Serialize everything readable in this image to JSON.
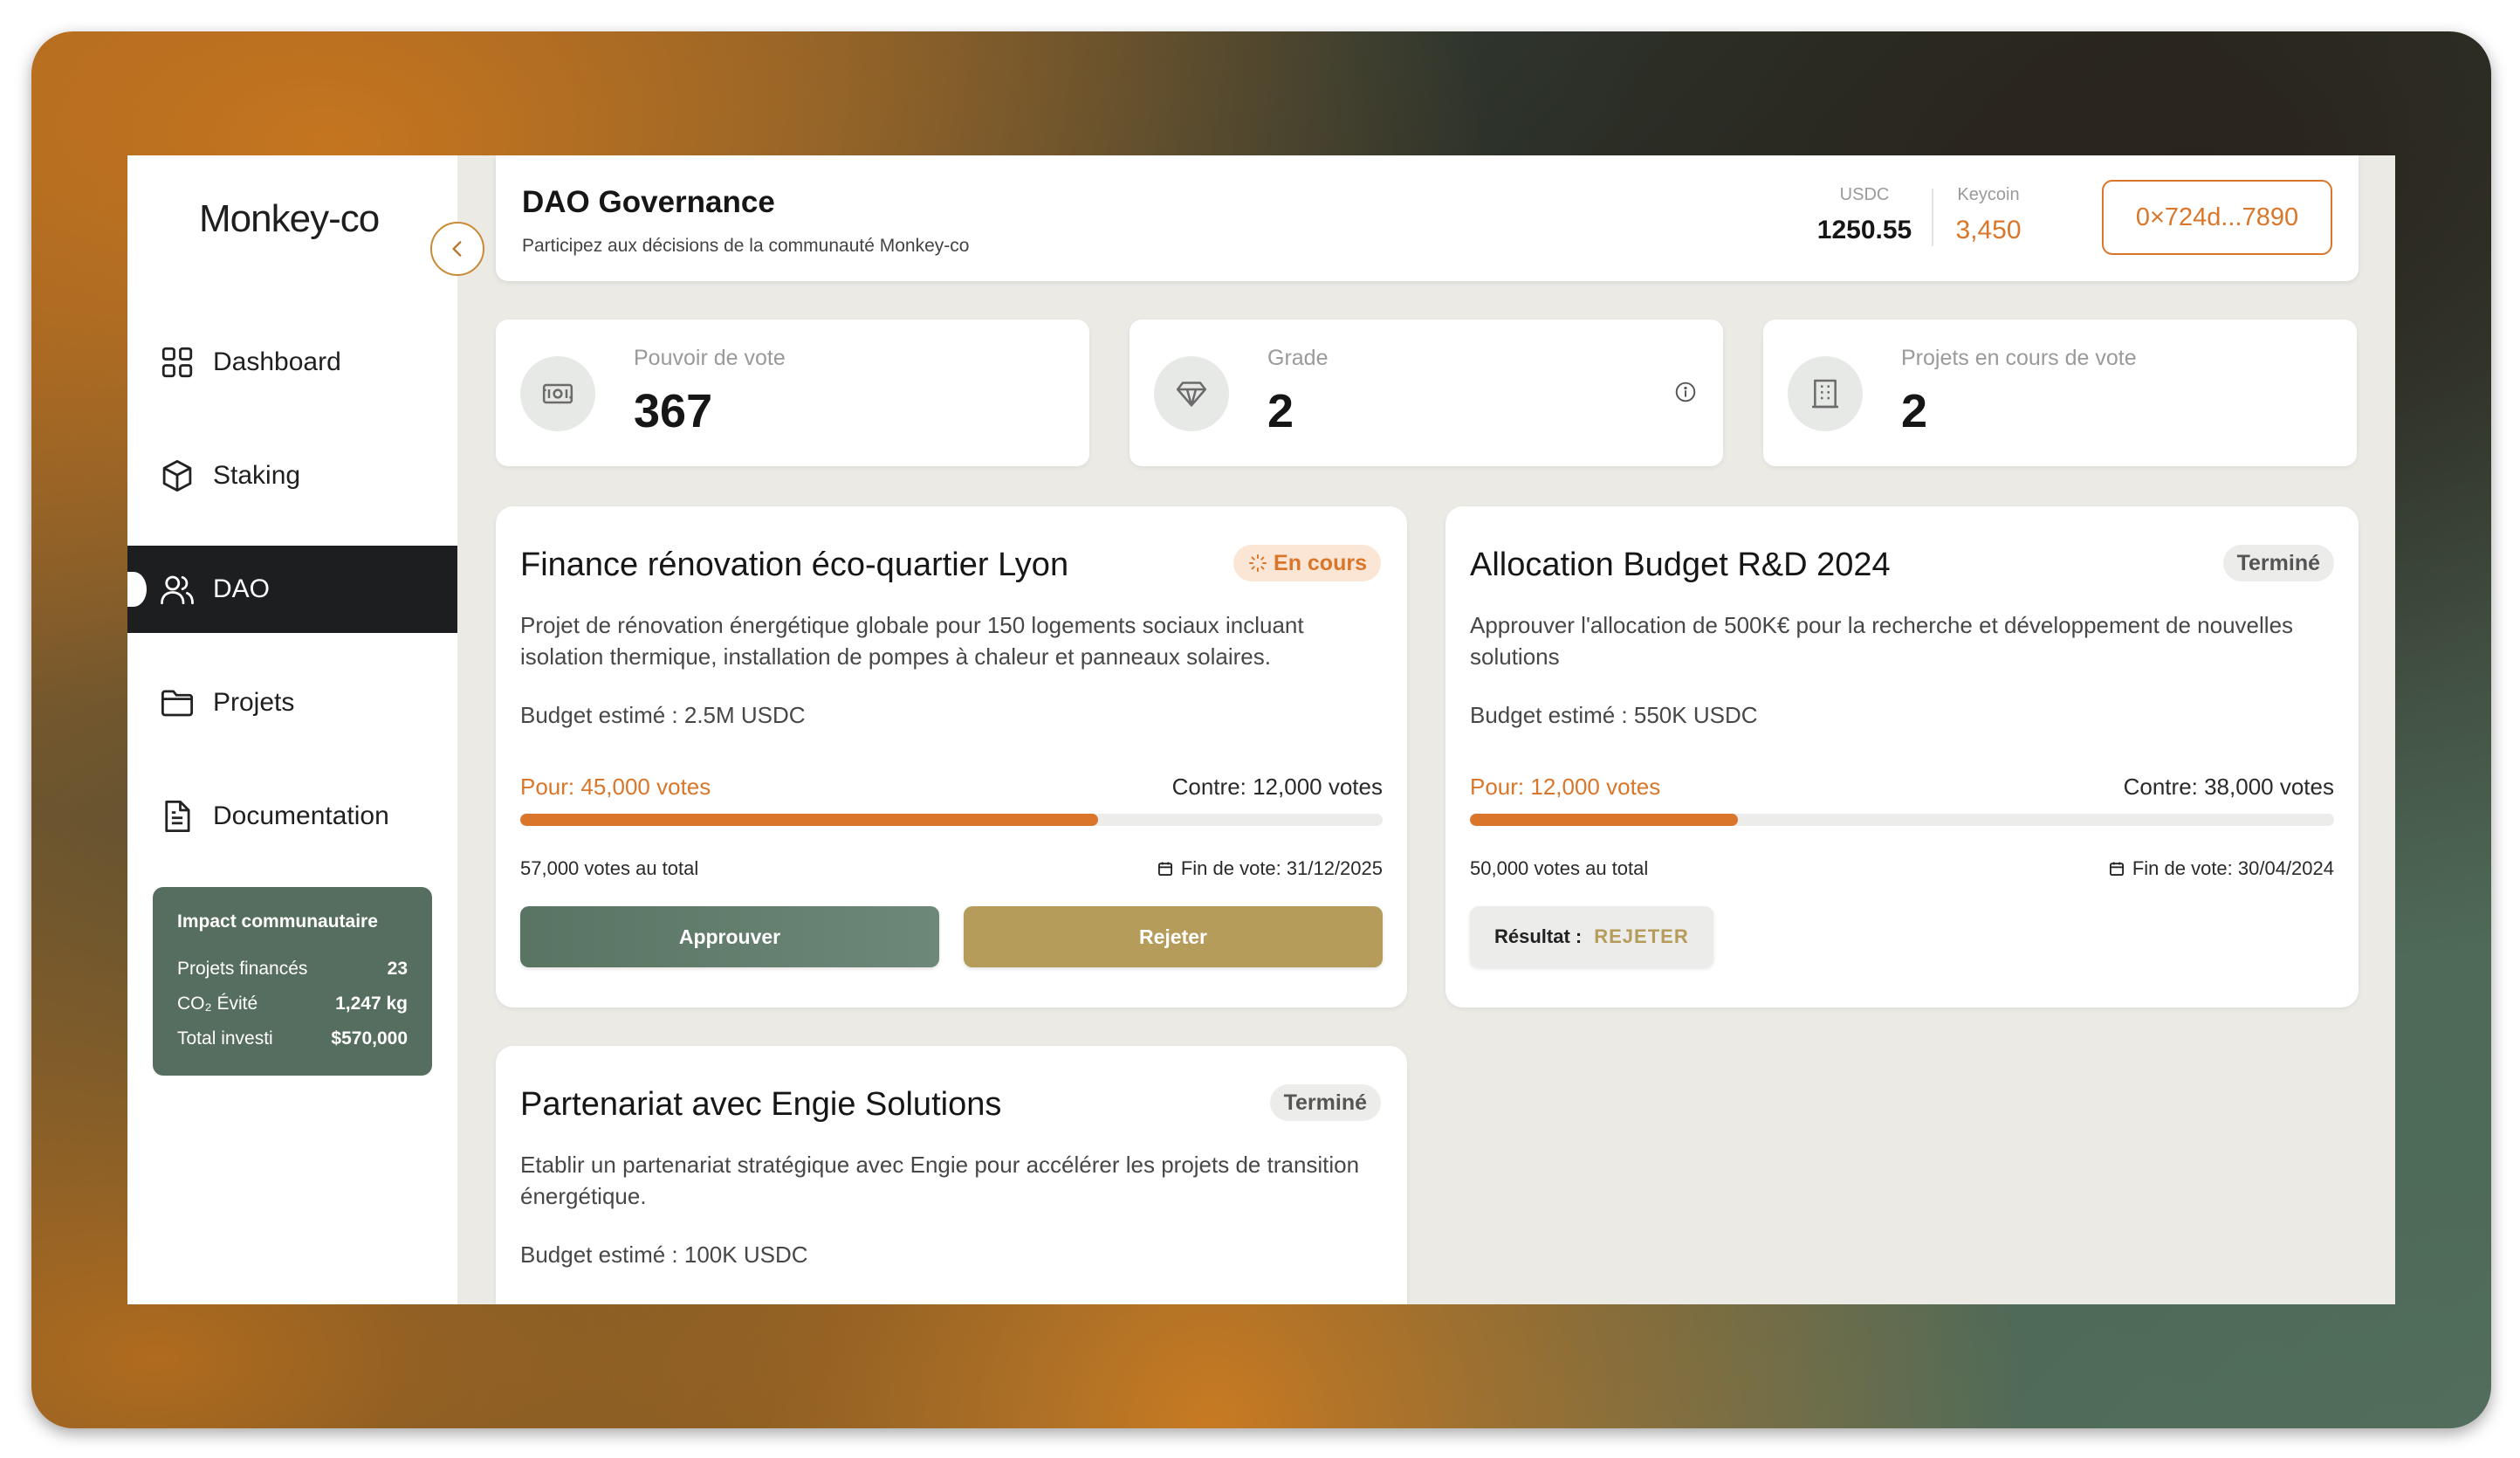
{
  "app": {
    "logo": "Monkey-co"
  },
  "sidebar": {
    "items": [
      {
        "label": "Dashboard",
        "icon": "grid-icon",
        "active": false
      },
      {
        "label": "Staking",
        "icon": "cube-icon",
        "active": false
      },
      {
        "label": "DAO",
        "icon": "users-icon",
        "active": true
      },
      {
        "label": "Projets",
        "icon": "folder-icon",
        "active": false
      },
      {
        "label": "Documentation",
        "icon": "document-icon",
        "active": false
      }
    ],
    "impact": {
      "title": "Impact communautaire",
      "rows": [
        {
          "label": "Projets financés",
          "value": "23"
        },
        {
          "label": "CO₂ Évité",
          "value": "1,247 kg"
        },
        {
          "label": "Total investi",
          "value": "$570,000"
        }
      ]
    }
  },
  "header": {
    "title": "DAO Governance",
    "subtitle": "Participez aux décisions de la communauté Monkey-co",
    "usdc_label": "USDC",
    "usdc_value": "1250.55",
    "keycoin_label": "Keycoin",
    "keycoin_value": "3,450",
    "wallet": "0×724d...7890"
  },
  "stats": [
    {
      "label": "Pouvoir de vote",
      "value": "367",
      "icon": "ticket-icon"
    },
    {
      "label": "Grade",
      "value": "2",
      "icon": "diamond-icon"
    },
    {
      "label": "Projets en cours de vote",
      "value": "2",
      "icon": "building-icon"
    }
  ],
  "proposals": [
    {
      "title": "Finance rénovation éco-quartier Lyon",
      "status": "En cours",
      "description": "Projet de rénovation énergétique globale pour 150 logements sociaux incluant isolation thermique, installation de pompes à chaleur et panneaux solaires.",
      "budget": "Budget estimé : 2.5M USDC",
      "pour": "Pour: 45,000 votes",
      "contre": "Contre: 12,000 votes",
      "pour_fraction": 0.67,
      "total": "57,000 votes au total",
      "end": "Fin de vote: 31/12/2025",
      "approve_label": "Approuver",
      "reject_label": "Rejeter"
    },
    {
      "title": "Allocation Budget R&D 2024",
      "status": "Terminé",
      "description": "Approuver l'allocation de 500K€ pour la recherche et développement de nouvelles solutions",
      "budget": "Budget estimé : 550K USDC",
      "pour": "Pour: 12,000 votes",
      "contre": "Contre: 38,000 votes",
      "pour_fraction": 0.31,
      "total": "50,000 votes au total",
      "end": "Fin de vote: 30/04/2024",
      "result_label": "Résultat :",
      "result_value": "REJETER"
    },
    {
      "title": "Partenariat avec Engie Solutions",
      "status": "Terminé",
      "description": "Etablir un partenariat stratégique avec Engie pour accélérer les projets de transition énergétique.",
      "budget": "Budget estimé : 100K USDC"
    }
  ],
  "colors": {
    "accent": "#d9762a",
    "sidebar_active": "#1d1e20",
    "green": "#566e5f",
    "gold": "#b59c5b"
  }
}
